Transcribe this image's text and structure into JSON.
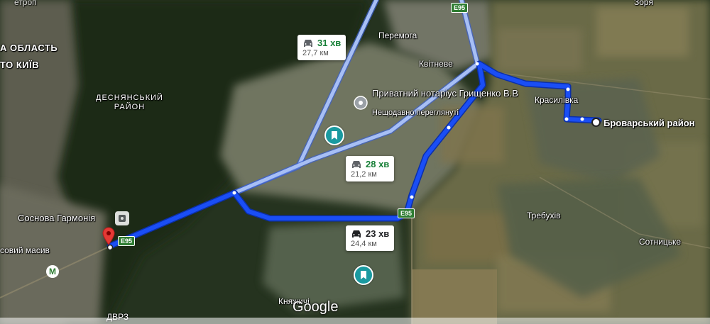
{
  "map": {
    "place_labels": {
      "oblast": "А ОБЛАСТЬ",
      "kyiv": "ТО КИЇВ",
      "desnianskyi": "ДЕСНЯНСЬКИЙ\nРАЙОН",
      "peremoha": "Перемога",
      "kvitneve": "Квітневе",
      "krasylivka": "Красилівка",
      "brovarskyi": "Броварський район",
      "trebukhiv": "Требухів",
      "sotnytske": "Сотницьке",
      "sosnova": "Соснова Гармонія",
      "lisovyi_masyv": "совий масив",
      "kniazhychi": "Княжичі",
      "dvrz": "ДВРЗ",
      "zoria": "Зоря",
      "top_left": "етроп"
    },
    "poi": {
      "name": "Приватний нотаріус Грищенко В.В",
      "subtitle": "Нещодавно переглянуті"
    },
    "routes": [
      {
        "id": "alt1",
        "time": "31 хв",
        "distance": "27,7 км",
        "selected": false
      },
      {
        "id": "alt2",
        "time": "28 хв",
        "distance": "21,2 км",
        "selected": false
      },
      {
        "id": "main",
        "time": "23 хв",
        "distance": "24,4 км",
        "selected": true
      }
    ],
    "road_shields": [
      "E95",
      "E95",
      "E95"
    ],
    "metro_symbol": "M",
    "logo": "Google",
    "colors": {
      "selected_route": "#1a4ef5",
      "alt_route": "#9bb5f0",
      "origin_pin": "#e53935",
      "alt_time": "#188038",
      "poi_teal": "#1a9aa0"
    }
  }
}
